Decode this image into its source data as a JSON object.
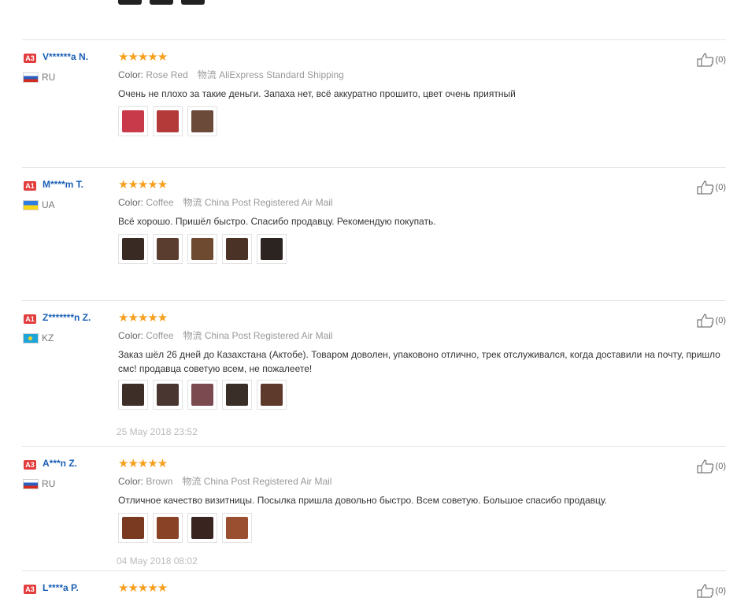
{
  "labels": {
    "color": "Color:"
  },
  "reviews": [
    {
      "badge": "A3",
      "user": "V******a N.",
      "country": "RU",
      "stars": "★★★★★",
      "color": "Rose Red",
      "shipping": "物流 AliExpress Standard Shipping",
      "text": "Очень не плохо за такие деньги. Запаха нет, всё аккуратно прошито, цвет очень приятный",
      "likes": "(0)",
      "date": "",
      "photos": [
        "#c83a4a",
        "#b43a3a",
        "#6b4a3a"
      ]
    },
    {
      "badge": "A1",
      "user": "M****m T.",
      "country": "UA",
      "stars": "★★★★★",
      "color": "Coffee",
      "shipping": "物流 China Post Registered Air Mail",
      "text": "Всё хорошо. Пришёл быстро. Спасибо продавцу. Рекомендую покупать.",
      "likes": "(0)",
      "date": "",
      "photos": [
        "#3a2a24",
        "#5a3d2e",
        "#6e4a30",
        "#4a3326",
        "#2c2420"
      ]
    },
    {
      "badge": "A1",
      "user": "Z*******n Z.",
      "country": "KZ",
      "stars": "★★★★★",
      "color": "Coffee",
      "shipping": "物流 China Post Registered Air Mail",
      "text": "Заказ шёл 26 дней до Казахстана (Актобе). Товаром доволен, упаковоно отлично, трек отслуживался, когда доставили на почту, пришло смс! продавца советую всем, не пожалеете!",
      "likes": "(0)",
      "date": "25 May 2018 23:52",
      "photos": [
        "#3d2e28",
        "#4a3630",
        "#7a4a50",
        "#3a2e28",
        "#5e3a2c"
      ]
    },
    {
      "badge": "A3",
      "user": "A***n Z.",
      "country": "RU",
      "stars": "★★★★★",
      "color": "Brown",
      "shipping": "物流 China Post Registered Air Mail",
      "text": "Отличное качество визитницы. Посылка пришла довольно быстро. Всем советую. Большое спасибо продавцу.",
      "likes": "(0)",
      "date": "04 May 2018 08:02",
      "photos": [
        "#7a3a22",
        "#8a4226",
        "#3a2420",
        "#9a5030"
      ]
    },
    {
      "badge": "A3",
      "user": "L****a P.",
      "country": "",
      "stars": "★★★★★",
      "color": "",
      "shipping": "",
      "text": "",
      "likes": "(0)",
      "date": "",
      "photos": []
    }
  ]
}
